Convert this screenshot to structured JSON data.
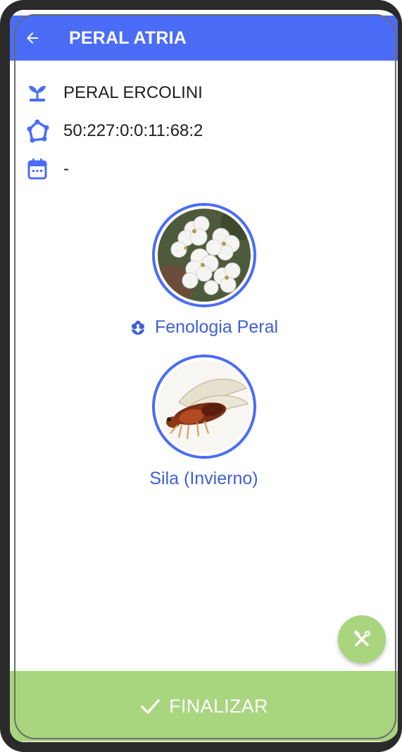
{
  "appbar": {
    "title": "PERAL ATRIA",
    "back_icon": "arrow-left-icon",
    "color": "#4a6cf7"
  },
  "info": {
    "variety": {
      "icon": "seedling-icon",
      "text": "PERAL ERCOLINI"
    },
    "plot": {
      "icon": "polygon-icon",
      "text": "50:227:0:0:11:68:2"
    },
    "date": {
      "icon": "calendar-icon",
      "text": "-"
    }
  },
  "cards": [
    {
      "label": "Fenologia Peral",
      "image": "pear-blossom-photo",
      "label_icon": "flower-icon"
    },
    {
      "label": "Sila (Invierno)",
      "image": "psylla-insect-photo"
    }
  ],
  "fab": {
    "icon": "tools-icon",
    "color": "#a8d57e"
  },
  "footer": {
    "label": "FINALIZAR",
    "icon": "check-icon",
    "color": "#a8d57e"
  }
}
